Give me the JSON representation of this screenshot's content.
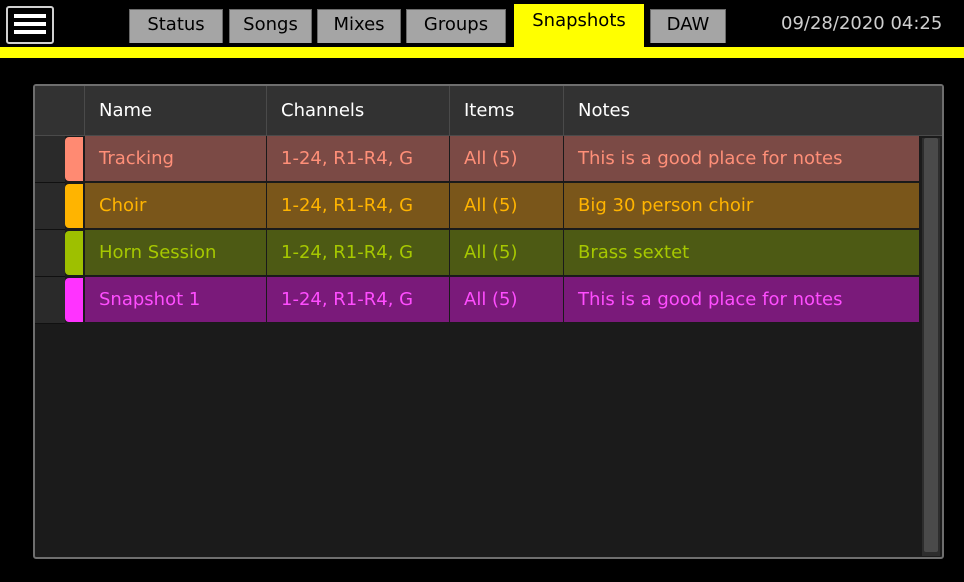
{
  "topbar": {
    "tabs": [
      {
        "label": "Status"
      },
      {
        "label": "Songs"
      },
      {
        "label": "Mixes"
      },
      {
        "label": "Groups"
      },
      {
        "label": "Snapshots"
      },
      {
        "label": "DAW"
      }
    ],
    "active_tab": "Snapshots",
    "datetime": "09/28/2020 04:25"
  },
  "table": {
    "headers": [
      "Name",
      "Channels",
      "Items",
      "Notes"
    ],
    "rows": [
      {
        "name": "Tracking",
        "channels": "1-24, R1-R4, G",
        "items": "All (5)",
        "notes": "This is a good place for notes",
        "swatch": "#ff8a72",
        "bg": "#7b4a45",
        "text_color": "#ff8f78"
      },
      {
        "name": "Choir",
        "channels": "1-24, R1-R4, G",
        "items": "All (5)",
        "notes": "Big 30 person choir",
        "swatch": "#ffb400",
        "bg": "#7a561a",
        "text_color": "#ffb400"
      },
      {
        "name": "Horn Session",
        "channels": "1-24, R1-R4, G",
        "items": "All (5)",
        "notes": "Brass sextet",
        "swatch": "#9ec000",
        "bg": "#4d5a14",
        "text_color": "#a6c800"
      },
      {
        "name": "Snapshot 1",
        "channels": "1-24, R1-R4, G",
        "items": "All (5)",
        "notes": "This is a good place for notes",
        "swatch": "#ff33ff",
        "bg": "#7a1a7a",
        "text_color": "#ff4dff"
      }
    ]
  },
  "colors": {
    "accent_yellow": "#ffff00",
    "tab_inactive": "#a5a5a5",
    "background": "#000000"
  },
  "icons": {
    "menu": "hamburger-menu-icon",
    "row_handle": "drag-handle-icon"
  }
}
